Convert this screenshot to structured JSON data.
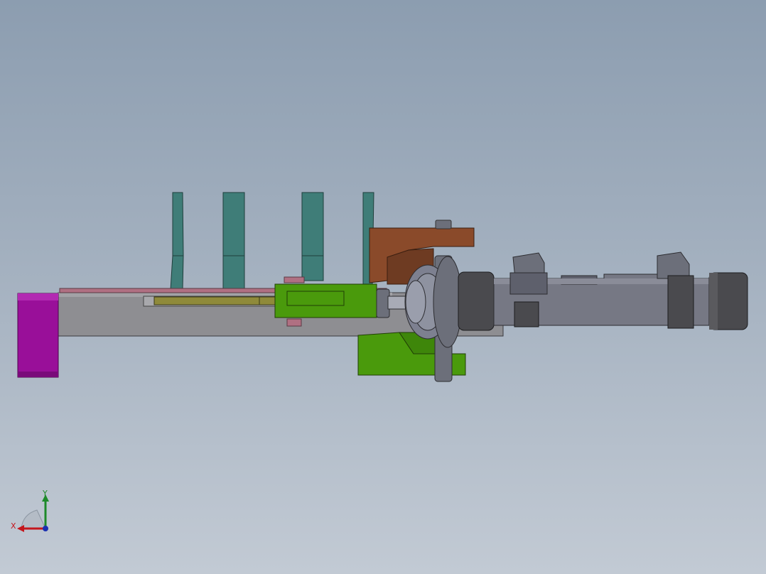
{
  "viewport": {
    "background_top": "#8c9db0",
    "background_bottom": "#c2cad4"
  },
  "model": {
    "colors": {
      "frame_gray": "#8e8e92",
      "bracket_magenta": "#990f99",
      "fins_teal": "#3f7d78",
      "slider_green": "#4a9a0c",
      "block_copper": "#8a4a2a",
      "cylinder_gray": "#767884",
      "nut_dark": "#4a4a4e",
      "rail_olive": "#8f8a3a",
      "strip_rose": "#b07082"
    }
  },
  "triad": {
    "x_label": "X",
    "y_label": "Y",
    "x_color": "#c4161c",
    "y_color": "#1d8a2a",
    "z_color": "#1a2fb0"
  }
}
